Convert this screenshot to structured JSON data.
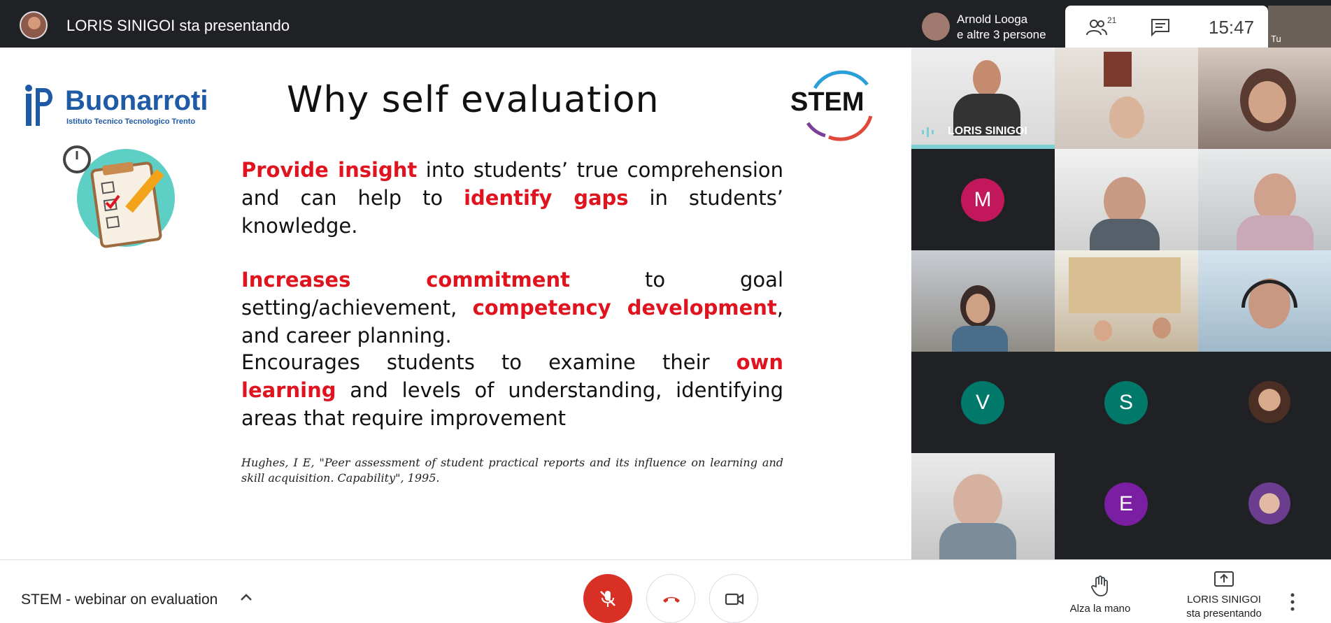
{
  "topbar": {
    "presenting_text": "LORIS SINIGOI sta presentando",
    "speaker_line1": "Arnold Looga",
    "speaker_line2": "e altre 3 persone",
    "people_count": "21",
    "clock": "15:47",
    "self_label": "Tu"
  },
  "slide": {
    "logo_name": "Buonarroti",
    "logo_subtitle": "Istituto Tecnico Tecnologico Trento",
    "title": "Why self evaluation",
    "stem_logo_text": "STEM",
    "p1": {
      "red1": "Provide insight",
      "t1": " into students’ true comprehension and can help to ",
      "red2": "identify gaps",
      "t2": " in students’ knowledge."
    },
    "p2": {
      "red1": "Increases commitment",
      "t1": " to goal setting/achievement, ",
      "red2": "competency development",
      "t2": ", and career planning."
    },
    "p3": {
      "t1": "Encourages students to examine their ",
      "red1": "own learning",
      "t2": " and levels of understanding, identifying areas that require improvement"
    },
    "citation": "Hughes, I E, \"Peer assessment of student practical reports and its influence on learning and skill acquisition. Capability\", 1995."
  },
  "participants": {
    "speaker_name": "LORIS SINIGOI",
    "initials": [
      "M",
      "V",
      "S",
      "E"
    ],
    "colors": {
      "M": "#c2185b",
      "V": "#00796b",
      "S": "#00796b",
      "E": "#7b1fa2"
    }
  },
  "bottombar": {
    "meeting_title": "STEM - webinar on evaluation",
    "raise_hand": "Alza la mano",
    "present_line1": "LORIS SINIGOI",
    "present_line2": "sta presentando"
  },
  "icons": [
    "people-icon",
    "chat-icon",
    "mic-off-icon",
    "hangup-icon",
    "camera-icon",
    "raise-hand-icon",
    "present-screen-icon",
    "more-vert-icon",
    "chevron-up-icon"
  ]
}
